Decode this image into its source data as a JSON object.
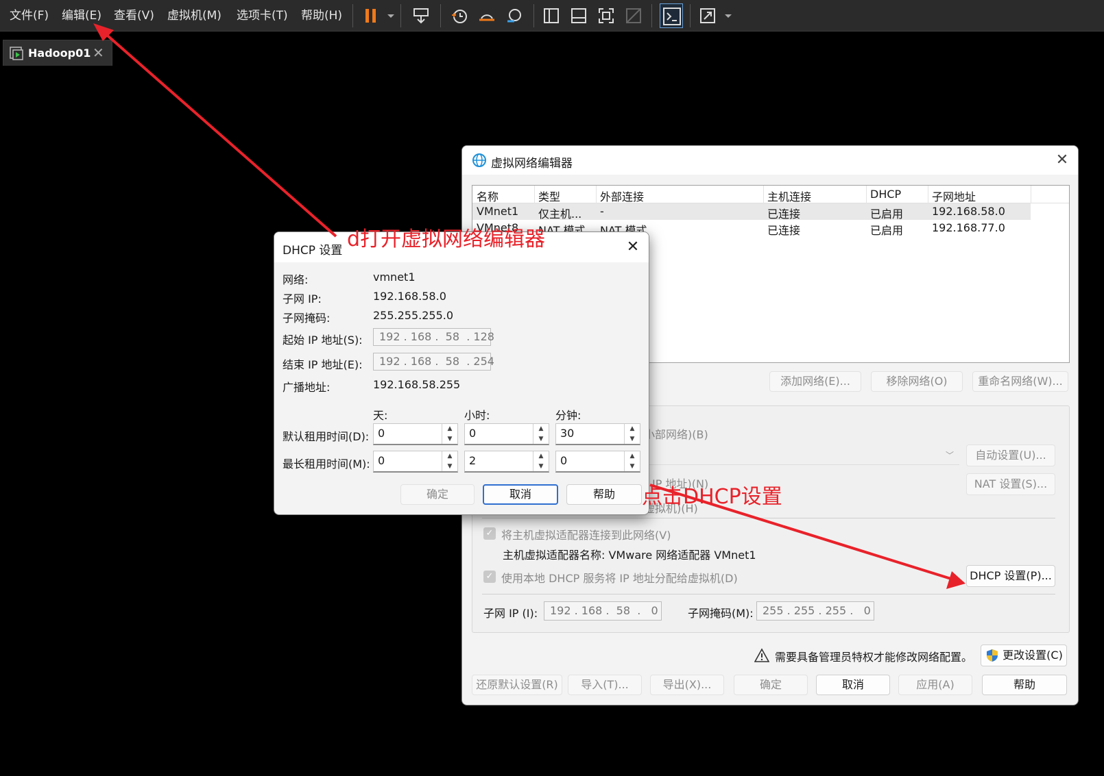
{
  "menubar": {
    "items": [
      "文件(F)",
      "编辑(E)",
      "查看(V)",
      "虚拟机(M)",
      "选项卡(T)",
      "帮助(H)"
    ]
  },
  "tab": {
    "label": "Hadoop01"
  },
  "annotations": {
    "arrow1_label": "d打开虚拟网络编辑器",
    "arrow2_label": "点击DHCP设置",
    "color": "#e8222a"
  },
  "vne": {
    "title": "虚拟网络编辑器",
    "columns": [
      "名称",
      "类型",
      "外部连接",
      "主机连接",
      "DHCP",
      "子网地址"
    ],
    "rows": [
      [
        "VMnet1",
        "仅主机...",
        "-",
        "已连接",
        "已启用",
        "192.168.58.0"
      ],
      [
        "VMnet8",
        "NAT 模式",
        "NAT 模式",
        "已连接",
        "已启用",
        "192.168.77.0"
      ]
    ],
    "add_network": "添加网络(E)...",
    "remove_network": "移除网络(O)",
    "rename_network": "重命名网络(W)...",
    "partial_bridge_text": "小部网络)(B)",
    "auto_settings": "自动设置(U)...",
    "partial_nat_text": "IP 地址)(N)",
    "nat_settings": "NAT 设置(S)...",
    "partial_hostonly_text": "虚拟机)(H)",
    "connect_host_adapter": "将主机虚拟适配器连接到此网络(V)",
    "host_adapter_name": "主机虚拟适配器名称: VMware 网络适配器 VMnet1",
    "use_local_dhcp": "使用本地 DHCP 服务将 IP 地址分配给虚拟机(D)",
    "dhcp_settings": "DHCP 设置(P)...",
    "subnet_ip_label": "子网 IP (I):",
    "subnet_ip_value": "192 . 168 .  58  .   0",
    "subnet_mask_label": "子网掩码(M):",
    "subnet_mask_value": "255 . 255 . 255 .   0",
    "admin_notice": "需要具备管理员特权才能修改网络配置。",
    "change_settings": "更改设置(C)",
    "restore_defaults": "还原默认设置(R)",
    "import": "导入(T)...",
    "export": "导出(X)...",
    "ok": "确定",
    "cancel": "取消",
    "apply": "应用(A)",
    "help": "帮助"
  },
  "dhcp": {
    "title": "DHCP 设置",
    "network_label": "网络:",
    "network_value": "vmnet1",
    "subnet_ip_label": "子网 IP:",
    "subnet_ip_value": "192.168.58.0",
    "subnet_mask_label": "子网掩码:",
    "subnet_mask_value": "255.255.255.0",
    "start_ip_label": "起始 IP 地址(S):",
    "start_ip_value": "192 . 168 .  58  . 128",
    "end_ip_label": "结束 IP 地址(E):",
    "end_ip_value": "192 . 168 .  58  . 254",
    "broadcast_label": "广播地址:",
    "broadcast_value": "192.168.58.255",
    "days_label": "天:",
    "hours_label": "小时:",
    "minutes_label": "分钟:",
    "default_lease_label": "默认租用时间(D):",
    "default_lease": [
      "0",
      "0",
      "30"
    ],
    "max_lease_label": "最长租用时间(M):",
    "max_lease": [
      "0",
      "2",
      "0"
    ],
    "ok": "确定",
    "cancel": "取消",
    "help": "帮助"
  }
}
